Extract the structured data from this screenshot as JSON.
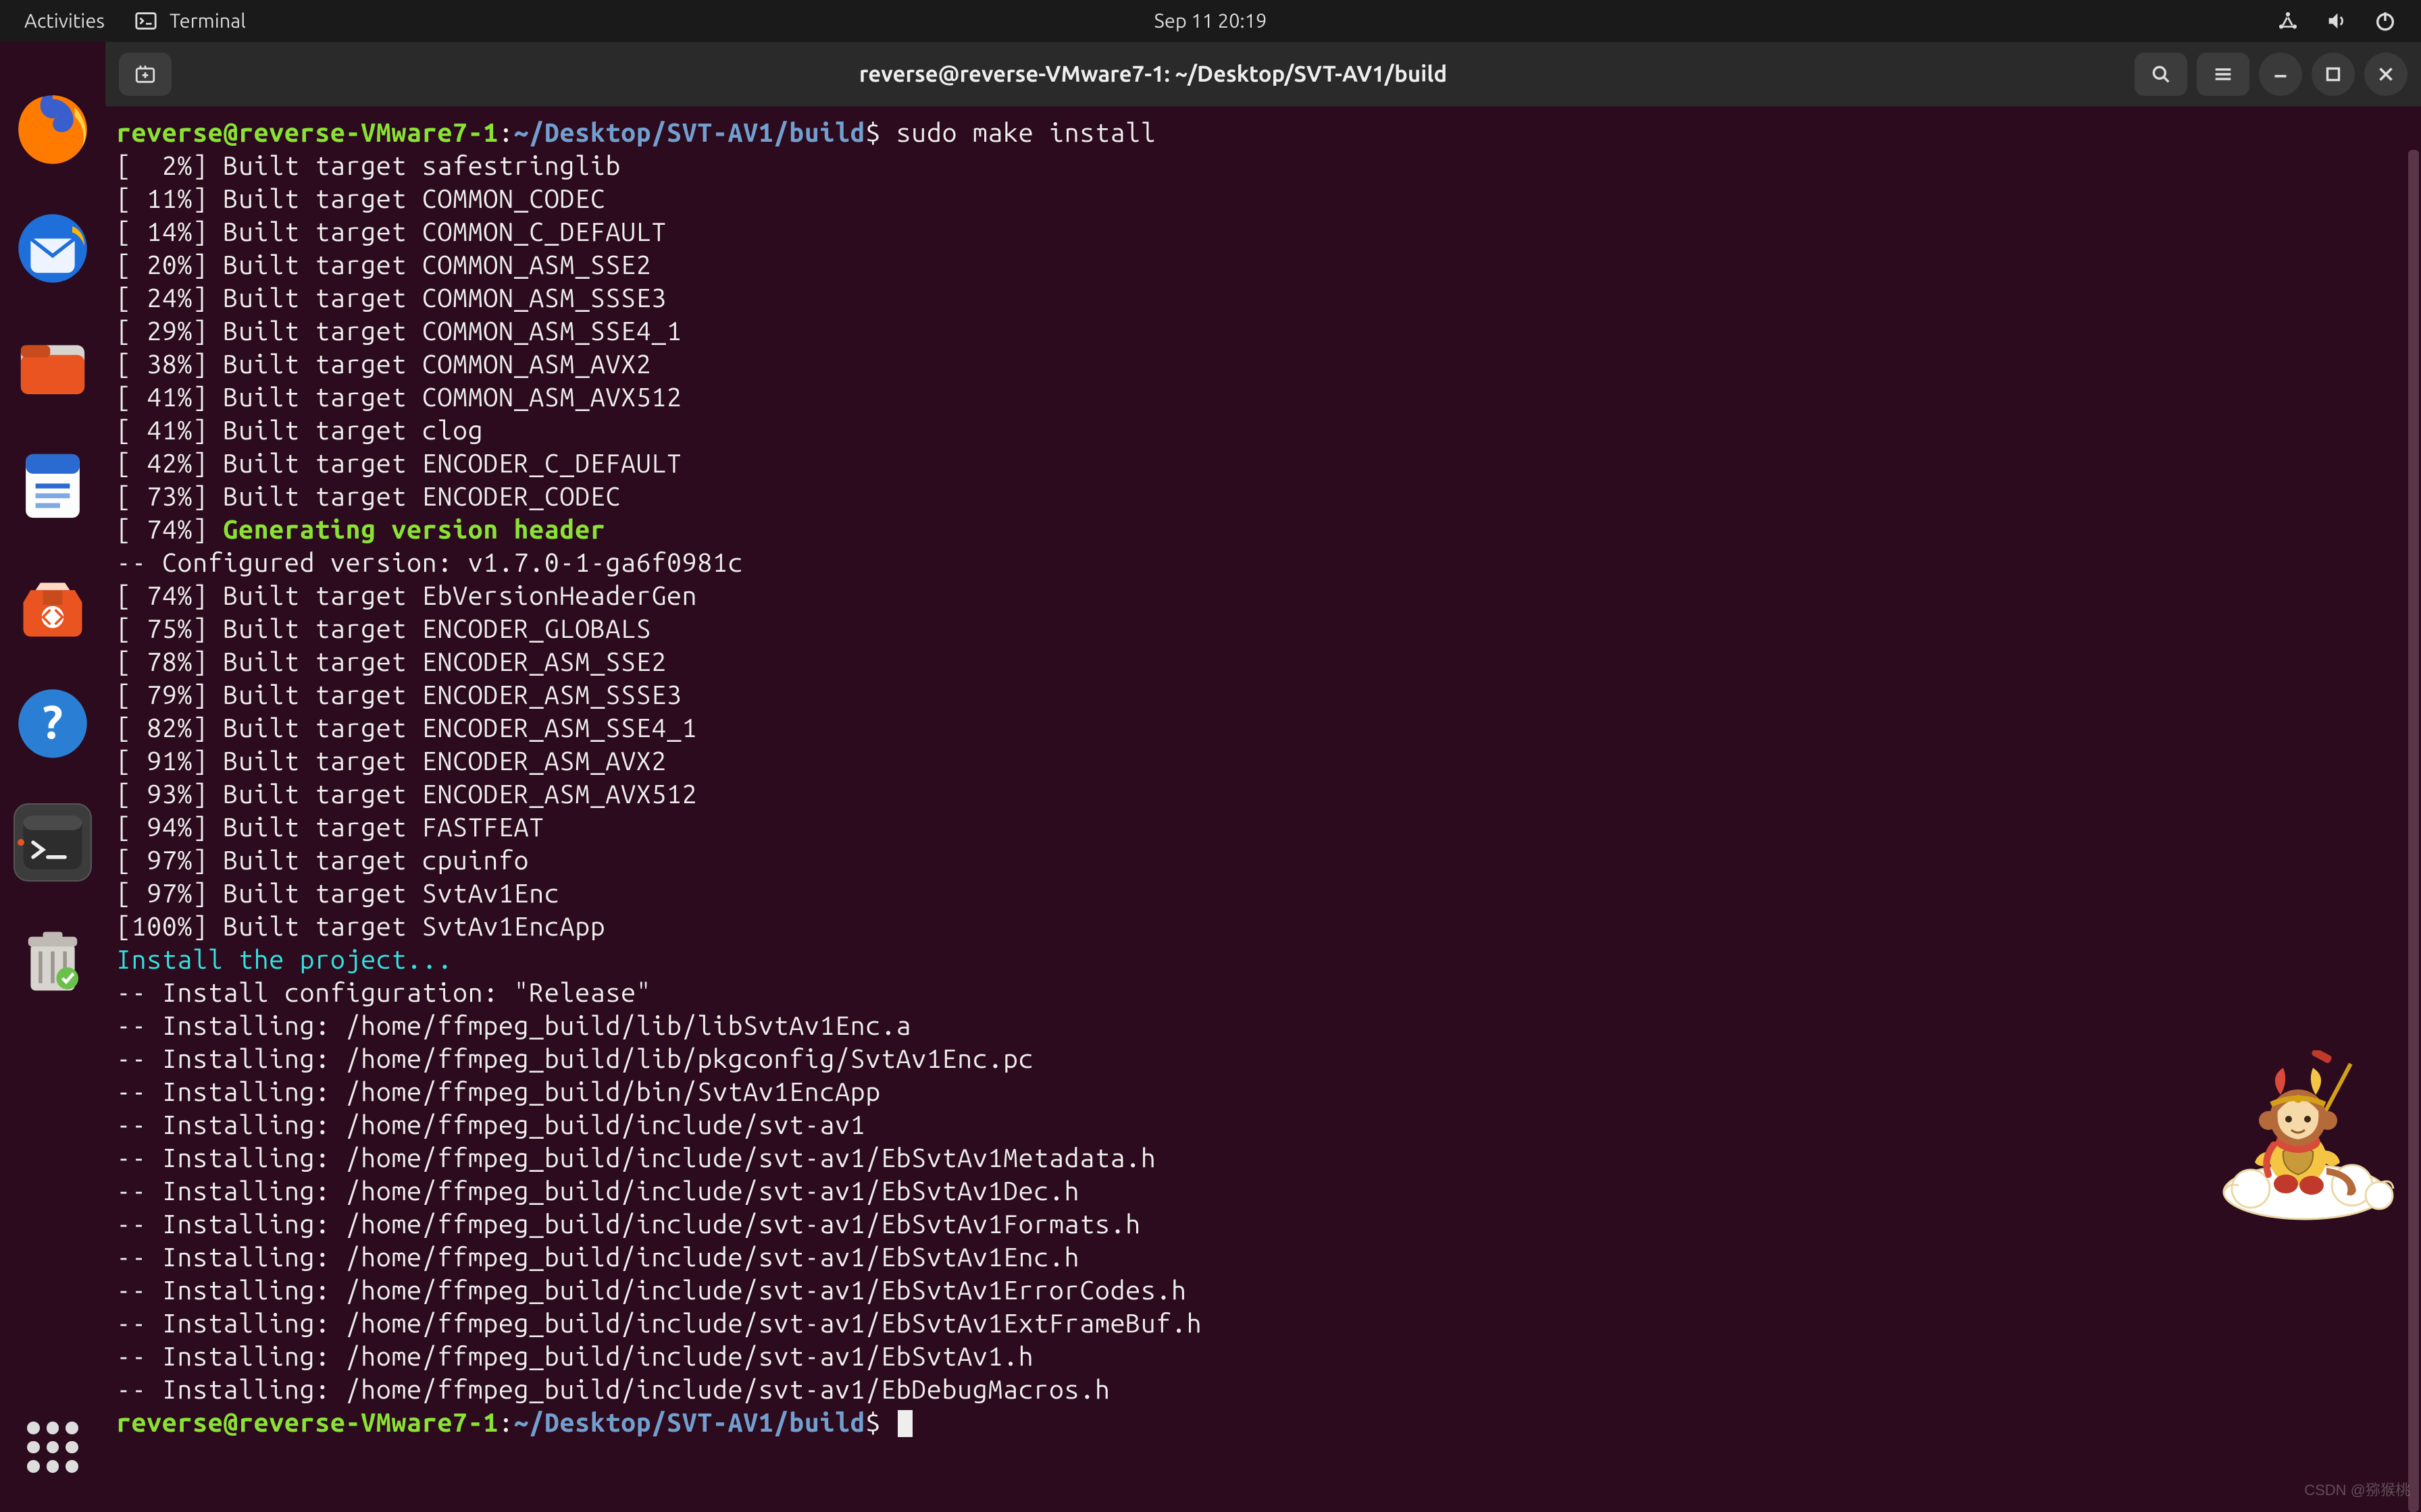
{
  "top_panel": {
    "activities": "Activities",
    "app_label": "Terminal",
    "clock": "Sep 11  20:19"
  },
  "dock": {
    "items": [
      {
        "name": "firefox-icon"
      },
      {
        "name": "thunderbird-icon"
      },
      {
        "name": "files-icon"
      },
      {
        "name": "writer-icon"
      },
      {
        "name": "software-icon"
      },
      {
        "name": "help-icon"
      },
      {
        "name": "terminal-icon"
      },
      {
        "name": "trash-icon"
      }
    ],
    "apps_label": "Show Applications"
  },
  "window": {
    "title": "reverse@reverse-VMware7-1: ~/Desktop/SVT-AV1/build"
  },
  "terminal": {
    "prompt_user": "reverse@reverse-VMware7-1",
    "prompt_colon": ":",
    "prompt_path": "~/Desktop/SVT-AV1/build",
    "prompt_symbol": "$",
    "command": "sudo make install",
    "build_lines": [
      {
        "pct": "  2%",
        "text": "Built target safestringlib"
      },
      {
        "pct": " 11%",
        "text": "Built target COMMON_CODEC"
      },
      {
        "pct": " 14%",
        "text": "Built target COMMON_C_DEFAULT"
      },
      {
        "pct": " 20%",
        "text": "Built target COMMON_ASM_SSE2"
      },
      {
        "pct": " 24%",
        "text": "Built target COMMON_ASM_SSSE3"
      },
      {
        "pct": " 29%",
        "text": "Built target COMMON_ASM_SSE4_1"
      },
      {
        "pct": " 38%",
        "text": "Built target COMMON_ASM_AVX2"
      },
      {
        "pct": " 41%",
        "text": "Built target COMMON_ASM_AVX512"
      },
      {
        "pct": " 41%",
        "text": "Built target clog"
      },
      {
        "pct": " 42%",
        "text": "Built target ENCODER_C_DEFAULT"
      },
      {
        "pct": " 73%",
        "text": "Built target ENCODER_CODEC"
      }
    ],
    "gen_line": {
      "pct": " 74%",
      "text": "Generating version header"
    },
    "config_version": "-- Configured version: v1.7.0-1-ga6f0981c",
    "build_lines_2": [
      {
        "pct": " 74%",
        "text": "Built target EbVersionHeaderGen"
      },
      {
        "pct": " 75%",
        "text": "Built target ENCODER_GLOBALS"
      },
      {
        "pct": " 78%",
        "text": "Built target ENCODER_ASM_SSE2"
      },
      {
        "pct": " 79%",
        "text": "Built target ENCODER_ASM_SSSE3"
      },
      {
        "pct": " 82%",
        "text": "Built target ENCODER_ASM_SSE4_1"
      },
      {
        "pct": " 91%",
        "text": "Built target ENCODER_ASM_AVX2"
      },
      {
        "pct": " 93%",
        "text": "Built target ENCODER_ASM_AVX512"
      },
      {
        "pct": " 94%",
        "text": "Built target FASTFEAT"
      },
      {
        "pct": " 97%",
        "text": "Built target cpuinfo"
      },
      {
        "pct": " 97%",
        "text": "Built target SvtAv1Enc"
      },
      {
        "pct": "100%",
        "text": "Built target SvtAv1EncApp"
      }
    ],
    "install_header": "Install the project...",
    "install_config": "-- Install configuration: \"Release\"",
    "install_lines": [
      "-- Installing: /home/ffmpeg_build/lib/libSvtAv1Enc.a",
      "-- Installing: /home/ffmpeg_build/lib/pkgconfig/SvtAv1Enc.pc",
      "-- Installing: /home/ffmpeg_build/bin/SvtAv1EncApp",
      "-- Installing: /home/ffmpeg_build/include/svt-av1",
      "-- Installing: /home/ffmpeg_build/include/svt-av1/EbSvtAv1Metadata.h",
      "-- Installing: /home/ffmpeg_build/include/svt-av1/EbSvtAv1Dec.h",
      "-- Installing: /home/ffmpeg_build/include/svt-av1/EbSvtAv1Formats.h",
      "-- Installing: /home/ffmpeg_build/include/svt-av1/EbSvtAv1Enc.h",
      "-- Installing: /home/ffmpeg_build/include/svt-av1/EbSvtAv1ErrorCodes.h",
      "-- Installing: /home/ffmpeg_build/include/svt-av1/EbSvtAv1ExtFrameBuf.h",
      "-- Installing: /home/ffmpeg_build/include/svt-av1/EbSvtAv1.h",
      "-- Installing: /home/ffmpeg_build/include/svt-av1/EbDebugMacros.h"
    ]
  },
  "watermark": "CSDN @猕猴桃"
}
